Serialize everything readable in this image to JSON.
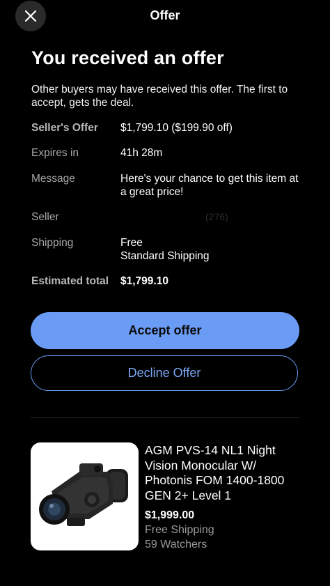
{
  "header": {
    "title": "Offer",
    "close_icon": "close-icon"
  },
  "main": {
    "heading": "You received an offer",
    "notice": "Other buyers may have received this offer. The first to accept, gets the deal."
  },
  "details": {
    "sellers_offer": {
      "label": "Seller's Offer",
      "value": "$1,799.10 ($199.90 off)"
    },
    "expires": {
      "label": "Expires in",
      "value": "41h 28m"
    },
    "message": {
      "label": "Message",
      "value": "Here's your chance to get this item at a great price!"
    },
    "seller": {
      "label": "Seller",
      "value": "(276)"
    },
    "shipping": {
      "label": "Shipping",
      "value_line1": "Free",
      "value_line2": "Standard Shipping"
    },
    "estimated_total": {
      "label": "Estimated total",
      "value": "$1,799.10"
    }
  },
  "actions": {
    "accept_label": "Accept offer",
    "decline_label": "Decline Offer"
  },
  "item": {
    "title": "AGM PVS-14 NL1 Night Vision Monocular W/ Photonis FOM 1400-1800 GEN 2+ Level 1",
    "price": "$1,999.00",
    "shipping": "Free Shipping",
    "watchers": "59 Watchers"
  },
  "colors": {
    "accent": "#6b9cf5",
    "background": "#000000",
    "muted_text": "#a8a8a8"
  }
}
